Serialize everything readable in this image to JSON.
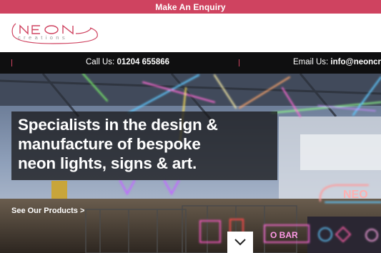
{
  "enquiry_bar": {
    "label": "Make An Enquiry"
  },
  "logo": {
    "word": "NEON",
    "subtext": "creations"
  },
  "contact": {
    "phone_label": "Call Us:",
    "phone_number": "01204 655866",
    "email_label": "Email Us:",
    "email_address": "info@neoncreati"
  },
  "hero": {
    "headline_line1": "Specialists in the design &",
    "headline_line2": "manufacture of bespoke",
    "headline_line3": "neon lights, signs & art.",
    "cta_label": "See Our Products >",
    "scroll_icon": "chevron-down-icon",
    "sign_text_1": "O BAR",
    "sign_text_2": "NEO"
  },
  "colors": {
    "brand_pink": "#cf4360",
    "contact_bar": "#0f0f10",
    "hero_overlay": "#19191c"
  }
}
